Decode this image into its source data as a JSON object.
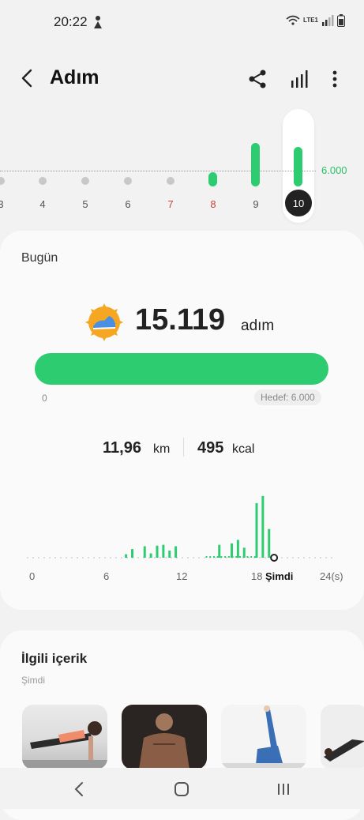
{
  "status": {
    "time": "20:22",
    "network": "LTE1"
  },
  "header": {
    "title": "Adım"
  },
  "strip": {
    "goal_label": "6.000",
    "days": [
      {
        "label": "3",
        "steps": 0,
        "weekend": false
      },
      {
        "label": "4",
        "steps": 0,
        "weekend": false
      },
      {
        "label": "5",
        "steps": 0,
        "weekend": false
      },
      {
        "label": "6",
        "steps": 0,
        "weekend": false
      },
      {
        "label": "7",
        "steps": 0,
        "weekend": true
      },
      {
        "label": "8",
        "steps": 2000,
        "weekend": true
      },
      {
        "label": "9",
        "steps": 15000,
        "weekend": false
      },
      {
        "label": "10",
        "steps": 15119,
        "weekend": false,
        "selected": true
      }
    ]
  },
  "today": {
    "title": "Bugün",
    "steps": "15.119",
    "unit": "adım",
    "progress_start": "0",
    "goal": "Hedef: 6.000",
    "progress_fraction": 1.0,
    "distance": "11,96",
    "distance_unit": "km",
    "calories": "495",
    "calories_unit": "kcal"
  },
  "hourly": {
    "x_labels": [
      "0",
      "6",
      "12",
      "18"
    ],
    "end_label": "24(s)",
    "now_label": "Şimdi",
    "bars": [
      {
        "h": 7.5,
        "v": 12
      },
      {
        "h": 8,
        "v": 30
      },
      {
        "h": 9,
        "v": 40
      },
      {
        "h": 9.5,
        "v": 15
      },
      {
        "h": 10,
        "v": 42
      },
      {
        "h": 10.5,
        "v": 45
      },
      {
        "h": 11,
        "v": 25
      },
      {
        "h": 11.5,
        "v": 40
      },
      {
        "h": 15,
        "v": 45
      },
      {
        "h": 16,
        "v": 50
      },
      {
        "h": 16.5,
        "v": 62
      },
      {
        "h": 17,
        "v": 35
      },
      {
        "h": 18,
        "v": 190
      },
      {
        "h": 18.5,
        "v": 215
      },
      {
        "h": 19,
        "v": 100
      }
    ]
  },
  "related": {
    "title": "İlgili içerik",
    "subtitle": "Şimdi"
  },
  "colors": {
    "accent": "#2ecc71",
    "goal_text": "#2bbf63",
    "weekend": "#c9443c"
  }
}
